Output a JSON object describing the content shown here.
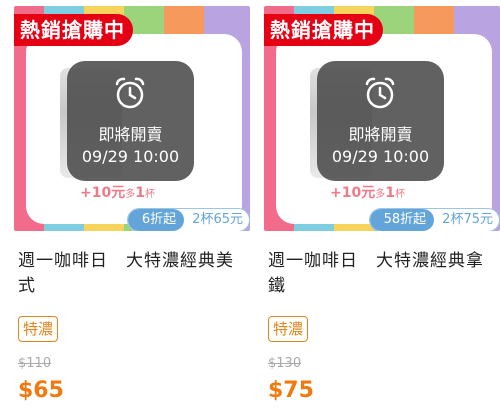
{
  "products": [
    {
      "badge": "熱銷搶購中",
      "overlay_label": "即將開賣",
      "overlay_time": "09/29 10:00",
      "promo_main": "+10元",
      "promo_mid": "多",
      "promo_num": "1",
      "promo_unit": "杯",
      "discount_tag": "6折起",
      "bundle_tag": "2杯65元",
      "title": "週一咖啡日　大特濃經典美式",
      "label": "特濃",
      "original_price": "$110",
      "sale_price": "$65"
    },
    {
      "badge": "熱銷搶購中",
      "overlay_label": "即將開賣",
      "overlay_time": "09/29 10:00",
      "promo_main": "+10元",
      "promo_mid": "多",
      "promo_num": "1",
      "promo_unit": "杯",
      "discount_tag": "58折起",
      "bundle_tag": "2杯75元",
      "title": "週一咖啡日　大特濃經典拿鐵",
      "label": "特濃",
      "original_price": "$130",
      "sale_price": "$75"
    }
  ],
  "colors": {
    "badge_red": "#e60014",
    "accent_orange": "#f07a10",
    "tag_blue": "#63a5d8",
    "promo_pink": "#f07a8a"
  },
  "icons": {
    "overlay": "alarm-clock-icon"
  }
}
